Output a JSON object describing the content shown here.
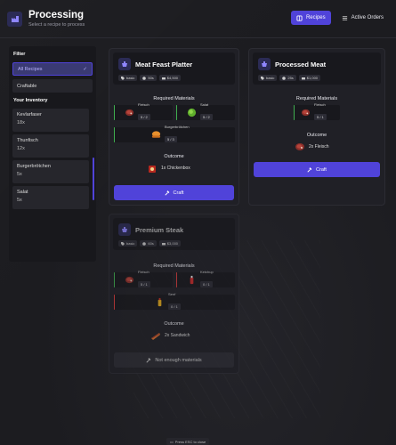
{
  "header": {
    "title": "Processing",
    "subtitle": "Select a recipe to process",
    "tabs": [
      {
        "label": "Recipes",
        "active": true
      },
      {
        "label": "Active Orders",
        "active": false
      }
    ]
  },
  "sidebar": {
    "filter_heading": "Filter",
    "filters": [
      {
        "label": "All Recipes",
        "active": true
      },
      {
        "label": "Craftable",
        "active": false
      }
    ],
    "inventory_heading": "Your Inventory",
    "inventory": [
      {
        "name": "Kevlarfaser",
        "qty": "18x"
      },
      {
        "name": "Thunfisch",
        "qty": "12x"
      },
      {
        "name": "Burgerbrötchen",
        "qty": "5x"
      },
      {
        "name": "Salat",
        "qty": "5x"
      }
    ]
  },
  "recipes": [
    {
      "title": "Meat Feast Platter",
      "badges": [
        "basic",
        "50s",
        "$4,500"
      ],
      "required_label": "Required Materials",
      "materials": [
        {
          "name": "Fleisch",
          "qty": "5 / 2",
          "icon": "meat-icon",
          "ok": true
        },
        {
          "name": "Salat",
          "qty": "5 / 2",
          "icon": "lettuce-icon",
          "ok": true
        },
        {
          "name": "Burgerbrötchen",
          "qty": "5 / 3",
          "icon": "bun-icon",
          "ok": true
        }
      ],
      "outcome_label": "Outcome",
      "outcome": "1x Chickenbox",
      "button": "Craft"
    },
    {
      "title": "Processed Meat",
      "badges": [
        "basic",
        "25s",
        "$1,000"
      ],
      "required_label": "Required Materials",
      "materials": [
        {
          "name": "Fleisch",
          "qty": "5 / 1",
          "icon": "meat-icon",
          "ok": true
        }
      ],
      "outcome_label": "Outcome",
      "outcome": "2x Fleisch",
      "button": "Craft"
    },
    {
      "title": "Premium Steak",
      "badges": [
        "basic",
        "60s",
        "$3,000"
      ],
      "required_label": "Required Materials",
      "materials": [
        {
          "name": "Fleisch",
          "qty": "5 / 1",
          "icon": "meat-icon",
          "ok": true
        },
        {
          "name": "Ketchup",
          "qty": "0 / 1",
          "icon": "ketchup-icon",
          "ok": false
        },
        {
          "name": "Senf",
          "qty": "0 / 1",
          "icon": "mustard-icon",
          "ok": false
        }
      ],
      "outcome_label": "Outcome",
      "outcome": "2x Sandwich",
      "button": "Not enough materials"
    }
  ],
  "footer": {
    "hint": "Press ESC to close"
  },
  "colors": {
    "accent": "#5043d9",
    "ok": "#3fae4f",
    "missing": "#d63b3b"
  }
}
